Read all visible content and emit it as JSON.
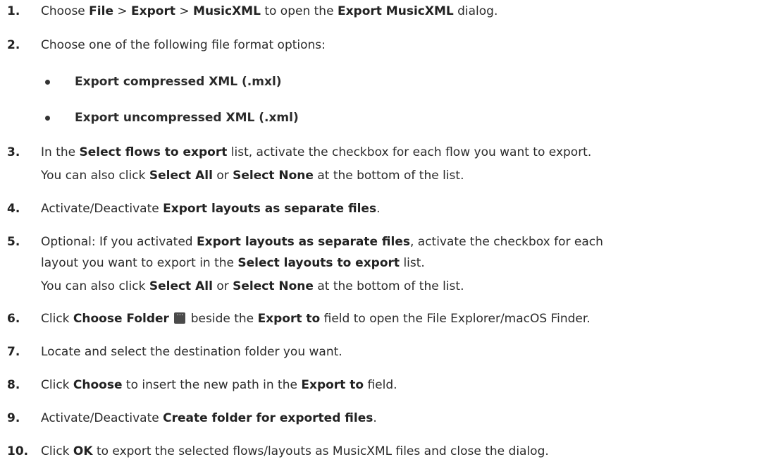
{
  "steps": [
    {
      "num": "1.",
      "parts": [
        "Choose ",
        "File",
        " > ",
        "Export",
        " > ",
        "MusicXML",
        " to open the ",
        "Export MusicXML",
        " dialog."
      ]
    },
    {
      "num": "2.",
      "text": "Choose one of the following file format options:"
    },
    {
      "num": "3.",
      "parts": [
        "In the ",
        "Select flows to export",
        " list, activate the checkbox for each flow you want to export."
      ],
      "sub": [
        "You can also click ",
        "Select All",
        " or ",
        "Select None",
        " at the bottom of the list."
      ]
    },
    {
      "num": "4.",
      "parts": [
        "Activate/Deactivate ",
        "Export layouts as separate files",
        "."
      ]
    },
    {
      "num": "5.",
      "parts": [
        "Optional: If you activated ",
        "Export layouts as separate files",
        ", activate the checkbox for each"
      ],
      "parts2": [
        "layout you want to export in the ",
        "Select layouts to export",
        " list."
      ],
      "sub": [
        "You can also click ",
        "Select All",
        " or ",
        "Select None",
        " at the bottom of the list."
      ]
    },
    {
      "num": "6.",
      "parts": [
        "Click ",
        "Choose Folder",
        " beside the ",
        "Export to",
        " field to open the File Explorer/macOS Finder."
      ]
    },
    {
      "num": "7.",
      "text": "Locate and select the destination folder you want."
    },
    {
      "num": "8.",
      "parts": [
        "Click ",
        "Choose",
        " to insert the new path in the ",
        "Export to",
        " field."
      ]
    },
    {
      "num": "9.",
      "parts": [
        "Activate/Deactivate ",
        "Create folder for exported files",
        "."
      ]
    },
    {
      "num": "10.",
      "parts": [
        "Click ",
        "OK",
        " to export the selected flows/layouts as MusicXML files and close the dialog."
      ]
    }
  ],
  "options": [
    "Export compressed XML (.mxl)",
    "Export uncompressed XML (.xml)"
  ],
  "icons": {
    "choose_folder": "ellipsis-folder-icon"
  }
}
